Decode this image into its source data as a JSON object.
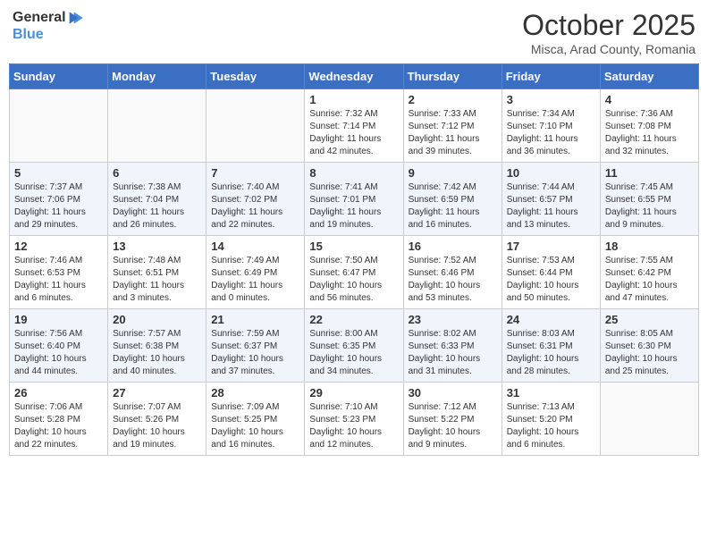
{
  "header": {
    "logo_general": "General",
    "logo_blue": "Blue",
    "month": "October 2025",
    "location": "Misca, Arad County, Romania"
  },
  "days_of_week": [
    "Sunday",
    "Monday",
    "Tuesday",
    "Wednesday",
    "Thursday",
    "Friday",
    "Saturday"
  ],
  "weeks": [
    [
      {
        "day": "",
        "sunrise": "",
        "sunset": "",
        "daylight": ""
      },
      {
        "day": "",
        "sunrise": "",
        "sunset": "",
        "daylight": ""
      },
      {
        "day": "",
        "sunrise": "",
        "sunset": "",
        "daylight": ""
      },
      {
        "day": "1",
        "sunrise": "Sunrise: 7:32 AM",
        "sunset": "Sunset: 7:14 PM",
        "daylight": "Daylight: 11 hours and 42 minutes."
      },
      {
        "day": "2",
        "sunrise": "Sunrise: 7:33 AM",
        "sunset": "Sunset: 7:12 PM",
        "daylight": "Daylight: 11 hours and 39 minutes."
      },
      {
        "day": "3",
        "sunrise": "Sunrise: 7:34 AM",
        "sunset": "Sunset: 7:10 PM",
        "daylight": "Daylight: 11 hours and 36 minutes."
      },
      {
        "day": "4",
        "sunrise": "Sunrise: 7:36 AM",
        "sunset": "Sunset: 7:08 PM",
        "daylight": "Daylight: 11 hours and 32 minutes."
      }
    ],
    [
      {
        "day": "5",
        "sunrise": "Sunrise: 7:37 AM",
        "sunset": "Sunset: 7:06 PM",
        "daylight": "Daylight: 11 hours and 29 minutes."
      },
      {
        "day": "6",
        "sunrise": "Sunrise: 7:38 AM",
        "sunset": "Sunset: 7:04 PM",
        "daylight": "Daylight: 11 hours and 26 minutes."
      },
      {
        "day": "7",
        "sunrise": "Sunrise: 7:40 AM",
        "sunset": "Sunset: 7:02 PM",
        "daylight": "Daylight: 11 hours and 22 minutes."
      },
      {
        "day": "8",
        "sunrise": "Sunrise: 7:41 AM",
        "sunset": "Sunset: 7:01 PM",
        "daylight": "Daylight: 11 hours and 19 minutes."
      },
      {
        "day": "9",
        "sunrise": "Sunrise: 7:42 AM",
        "sunset": "Sunset: 6:59 PM",
        "daylight": "Daylight: 11 hours and 16 minutes."
      },
      {
        "day": "10",
        "sunrise": "Sunrise: 7:44 AM",
        "sunset": "Sunset: 6:57 PM",
        "daylight": "Daylight: 11 hours and 13 minutes."
      },
      {
        "day": "11",
        "sunrise": "Sunrise: 7:45 AM",
        "sunset": "Sunset: 6:55 PM",
        "daylight": "Daylight: 11 hours and 9 minutes."
      }
    ],
    [
      {
        "day": "12",
        "sunrise": "Sunrise: 7:46 AM",
        "sunset": "Sunset: 6:53 PM",
        "daylight": "Daylight: 11 hours and 6 minutes."
      },
      {
        "day": "13",
        "sunrise": "Sunrise: 7:48 AM",
        "sunset": "Sunset: 6:51 PM",
        "daylight": "Daylight: 11 hours and 3 minutes."
      },
      {
        "day": "14",
        "sunrise": "Sunrise: 7:49 AM",
        "sunset": "Sunset: 6:49 PM",
        "daylight": "Daylight: 11 hours and 0 minutes."
      },
      {
        "day": "15",
        "sunrise": "Sunrise: 7:50 AM",
        "sunset": "Sunset: 6:47 PM",
        "daylight": "Daylight: 10 hours and 56 minutes."
      },
      {
        "day": "16",
        "sunrise": "Sunrise: 7:52 AM",
        "sunset": "Sunset: 6:46 PM",
        "daylight": "Daylight: 10 hours and 53 minutes."
      },
      {
        "day": "17",
        "sunrise": "Sunrise: 7:53 AM",
        "sunset": "Sunset: 6:44 PM",
        "daylight": "Daylight: 10 hours and 50 minutes."
      },
      {
        "day": "18",
        "sunrise": "Sunrise: 7:55 AM",
        "sunset": "Sunset: 6:42 PM",
        "daylight": "Daylight: 10 hours and 47 minutes."
      }
    ],
    [
      {
        "day": "19",
        "sunrise": "Sunrise: 7:56 AM",
        "sunset": "Sunset: 6:40 PM",
        "daylight": "Daylight: 10 hours and 44 minutes."
      },
      {
        "day": "20",
        "sunrise": "Sunrise: 7:57 AM",
        "sunset": "Sunset: 6:38 PM",
        "daylight": "Daylight: 10 hours and 40 minutes."
      },
      {
        "day": "21",
        "sunrise": "Sunrise: 7:59 AM",
        "sunset": "Sunset: 6:37 PM",
        "daylight": "Daylight: 10 hours and 37 minutes."
      },
      {
        "day": "22",
        "sunrise": "Sunrise: 8:00 AM",
        "sunset": "Sunset: 6:35 PM",
        "daylight": "Daylight: 10 hours and 34 minutes."
      },
      {
        "day": "23",
        "sunrise": "Sunrise: 8:02 AM",
        "sunset": "Sunset: 6:33 PM",
        "daylight": "Daylight: 10 hours and 31 minutes."
      },
      {
        "day": "24",
        "sunrise": "Sunrise: 8:03 AM",
        "sunset": "Sunset: 6:31 PM",
        "daylight": "Daylight: 10 hours and 28 minutes."
      },
      {
        "day": "25",
        "sunrise": "Sunrise: 8:05 AM",
        "sunset": "Sunset: 6:30 PM",
        "daylight": "Daylight: 10 hours and 25 minutes."
      }
    ],
    [
      {
        "day": "26",
        "sunrise": "Sunrise: 7:06 AM",
        "sunset": "Sunset: 5:28 PM",
        "daylight": "Daylight: 10 hours and 22 minutes."
      },
      {
        "day": "27",
        "sunrise": "Sunrise: 7:07 AM",
        "sunset": "Sunset: 5:26 PM",
        "daylight": "Daylight: 10 hours and 19 minutes."
      },
      {
        "day": "28",
        "sunrise": "Sunrise: 7:09 AM",
        "sunset": "Sunset: 5:25 PM",
        "daylight": "Daylight: 10 hours and 16 minutes."
      },
      {
        "day": "29",
        "sunrise": "Sunrise: 7:10 AM",
        "sunset": "Sunset: 5:23 PM",
        "daylight": "Daylight: 10 hours and 12 minutes."
      },
      {
        "day": "30",
        "sunrise": "Sunrise: 7:12 AM",
        "sunset": "Sunset: 5:22 PM",
        "daylight": "Daylight: 10 hours and 9 minutes."
      },
      {
        "day": "31",
        "sunrise": "Sunrise: 7:13 AM",
        "sunset": "Sunset: 5:20 PM",
        "daylight": "Daylight: 10 hours and 6 minutes."
      },
      {
        "day": "",
        "sunrise": "",
        "sunset": "",
        "daylight": ""
      }
    ]
  ]
}
